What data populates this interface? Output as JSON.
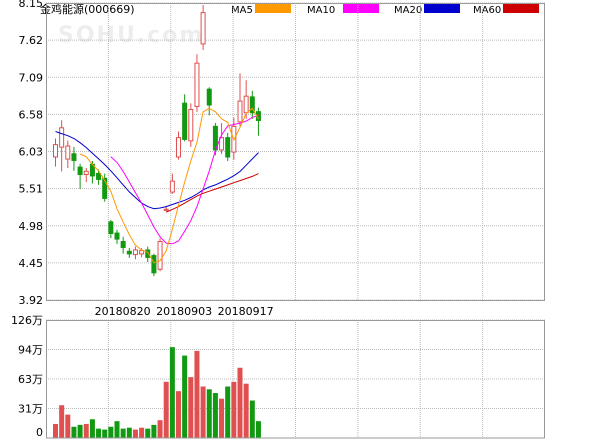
{
  "header": {
    "title": "金鸡能源(000669)",
    "watermark": "SOHU.com",
    "legend": [
      {
        "label": "MA5",
        "color": "#FF9900"
      },
      {
        "label": "MA10",
        "color": "#FF00FF"
      },
      {
        "label": "MA20",
        "color": "#0000CC"
      },
      {
        "label": "MA60",
        "color": "#CC0000"
      }
    ]
  },
  "colors": {
    "up": "#E05050",
    "down": "#119911",
    "grid": "#BBBBBB",
    "axis_text": "#000000"
  },
  "chart_data": [
    {
      "type": "candlestick",
      "name": "price",
      "yticks": [
        "8.15",
        "7.62",
        "7.09",
        "6.58",
        "6.03",
        "5.51",
        "4.98",
        "4.45",
        "3.92"
      ],
      "ylim": [
        3.92,
        8.15
      ],
      "xtick_labels": [
        {
          "label": "20180820",
          "index": 11
        },
        {
          "label": "20180903",
          "index": 21
        },
        {
          "label": "20180917",
          "index": 31
        }
      ],
      "candles": [
        {
          "o": 5.95,
          "c": 6.14,
          "h": 6.22,
          "l": 5.82
        },
        {
          "o": 6.09,
          "c": 6.38,
          "h": 6.48,
          "l": 5.75
        },
        {
          "o": 5.92,
          "c": 6.12,
          "h": 6.19,
          "l": 5.8
        },
        {
          "o": 6.01,
          "c": 5.9,
          "h": 6.1,
          "l": 5.76
        },
        {
          "o": 5.82,
          "c": 5.7,
          "h": 5.86,
          "l": 5.5
        },
        {
          "o": 5.7,
          "c": 5.76,
          "h": 5.8,
          "l": 5.6
        },
        {
          "o": 5.86,
          "c": 5.68,
          "h": 5.9,
          "l": 5.58
        },
        {
          "o": 5.73,
          "c": 5.63,
          "h": 5.78,
          "l": 5.56
        },
        {
          "o": 5.66,
          "c": 5.36,
          "h": 5.72,
          "l": 5.32
        },
        {
          "o": 5.04,
          "c": 4.86,
          "h": 5.06,
          "l": 4.8
        },
        {
          "o": 4.88,
          "c": 4.78,
          "h": 4.92,
          "l": 4.72
        },
        {
          "o": 4.76,
          "c": 4.66,
          "h": 4.82,
          "l": 4.58
        },
        {
          "o": 4.62,
          "c": 4.57,
          "h": 4.66,
          "l": 4.52
        },
        {
          "o": 4.56,
          "c": 4.64,
          "h": 4.68,
          "l": 4.5
        },
        {
          "o": 4.57,
          "c": 4.63,
          "h": 4.66,
          "l": 4.53
        },
        {
          "o": 4.64,
          "c": 4.52,
          "h": 4.68,
          "l": 4.46
        },
        {
          "o": 4.56,
          "c": 4.3,
          "h": 4.58,
          "l": 4.26
        },
        {
          "o": 4.35,
          "c": 4.76,
          "h": 4.8,
          "l": 4.33
        },
        {
          "o": 5.19,
          "c": 5.22,
          "h": 5.26,
          "l": 5.18
        },
        {
          "o": 5.45,
          "c": 5.62,
          "h": 5.72,
          "l": 5.43
        },
        {
          "o": 5.95,
          "c": 6.24,
          "h": 6.32,
          "l": 5.92
        },
        {
          "o": 6.73,
          "c": 6.2,
          "h": 6.85,
          "l": 6.18
        },
        {
          "o": 6.18,
          "c": 6.64,
          "h": 6.72,
          "l": 6.1
        },
        {
          "o": 6.67,
          "c": 7.3,
          "h": 7.42,
          "l": 6.6
        },
        {
          "o": 7.56,
          "c": 8.02,
          "h": 8.12,
          "l": 7.48
        },
        {
          "o": 6.93,
          "c": 6.69,
          "h": 6.95,
          "l": 6.55
        },
        {
          "o": 6.4,
          "c": 6.05,
          "h": 6.44,
          "l": 5.98
        },
        {
          "o": 6.05,
          "c": 6.24,
          "h": 6.44,
          "l": 6.0
        },
        {
          "o": 6.24,
          "c": 5.95,
          "h": 6.3,
          "l": 5.9
        },
        {
          "o": 6.02,
          "c": 6.4,
          "h": 6.52,
          "l": 5.92
        },
        {
          "o": 6.45,
          "c": 6.76,
          "h": 7.15,
          "l": 6.4
        },
        {
          "o": 6.58,
          "c": 6.83,
          "h": 7.05,
          "l": 6.5
        },
        {
          "o": 6.82,
          "c": 6.58,
          "h": 6.9,
          "l": 6.5
        },
        {
          "o": 6.61,
          "c": 6.47,
          "h": 6.66,
          "l": 6.26
        }
      ],
      "ma5": [
        null,
        null,
        null,
        null,
        6.0,
        5.96,
        5.85,
        5.76,
        5.62,
        5.47,
        5.22,
        5.03,
        4.85,
        4.7,
        4.63,
        4.6,
        4.45,
        4.48,
        4.62,
        4.93,
        5.27,
        5.6,
        5.9,
        6.17,
        6.6,
        6.65,
        6.6,
        6.5,
        6.45,
        6.2,
        6.38,
        6.58,
        6.65,
        6.5
      ],
      "ma10": [
        null,
        null,
        null,
        null,
        null,
        null,
        null,
        null,
        null,
        5.96,
        5.88,
        5.75,
        5.6,
        5.45,
        5.3,
        5.13,
        4.96,
        4.82,
        4.73,
        4.72,
        4.76,
        4.9,
        5.05,
        5.25,
        5.5,
        5.76,
        6.05,
        6.27,
        6.4,
        6.42,
        6.44,
        6.47,
        6.52,
        6.55
      ],
      "ma20": [
        6.32,
        6.29,
        6.26,
        6.22,
        6.16,
        6.09,
        6.01,
        5.93,
        5.85,
        5.76,
        5.66,
        5.56,
        5.46,
        5.38,
        5.3,
        5.25,
        5.22,
        5.23,
        5.25,
        5.28,
        5.31,
        5.34,
        5.38,
        5.43,
        5.49,
        5.53,
        5.56,
        5.6,
        5.64,
        5.69,
        5.75,
        5.84,
        5.93,
        6.02
      ],
      "ma60": [
        null,
        null,
        null,
        null,
        null,
        null,
        null,
        null,
        null,
        null,
        null,
        null,
        null,
        null,
        null,
        null,
        null,
        null,
        5.17,
        5.21,
        5.25,
        5.3,
        5.35,
        5.4,
        5.44,
        5.47,
        5.5,
        5.53,
        5.56,
        5.59,
        5.62,
        5.65,
        5.68,
        5.72
      ]
    },
    {
      "type": "bar",
      "name": "volume",
      "yticks": [
        "126万",
        "94万",
        "63万",
        "31万",
        "0"
      ],
      "ylim": [
        0,
        126
      ],
      "unit": "万",
      "values": [
        15,
        35,
        25,
        12,
        14,
        15,
        20,
        10,
        9,
        12,
        18,
        10,
        11,
        9,
        11,
        10,
        14,
        19,
        60,
        97,
        50,
        88,
        65,
        93,
        55,
        52,
        48,
        42,
        55,
        60,
        75,
        58,
        40,
        18
      ],
      "up": [
        true,
        true,
        true,
        false,
        false,
        true,
        false,
        false,
        false,
        false,
        false,
        false,
        false,
        true,
        true,
        false,
        false,
        true,
        true,
        false,
        true,
        false,
        true,
        true,
        true,
        false,
        false,
        true,
        false,
        true,
        true,
        true,
        false,
        false
      ]
    }
  ]
}
